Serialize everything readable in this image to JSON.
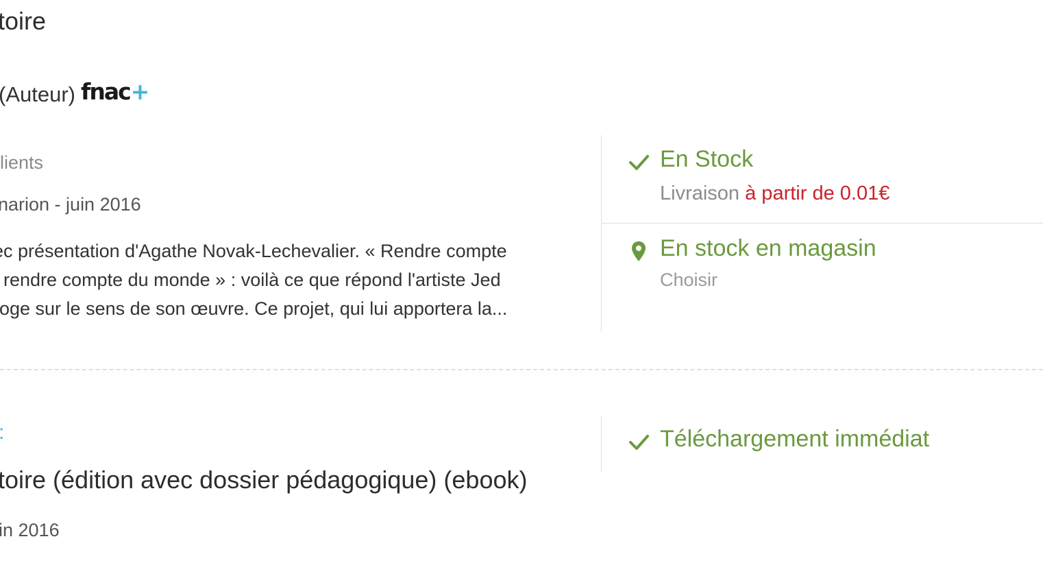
{
  "product": {
    "title_fragment": "toire",
    "author_label": "(Auteur)",
    "brand_logo": {
      "main": "fnac",
      "plus": "+",
      "accent": "#3fb6d9"
    },
    "reviews_fragment": "lients",
    "publication_fragment": "narion - juin 2016",
    "description_lines": [
      "ec présentation d'Agathe Novak-Lechevalier. « Rendre compte",
      "t rendre compte du monde » : voilà ce que répond l'artiste Jed",
      "roge sur le sens de son œuvre. Ce projet, qui lui apportera la..."
    ]
  },
  "availability": {
    "stock_icon": "checkmark-icon",
    "stock_label": "En Stock",
    "delivery_prefix": "Livraison",
    "delivery_price": "à partir de 0.01€",
    "store_icon": "map-pin-icon",
    "store_label": "En stock en magasin",
    "store_action": "Choisir",
    "colors": {
      "green": "#6a9a3e",
      "red": "#c8232c"
    }
  },
  "ebook": {
    "label_fragment": ":",
    "title_fragment": "toire (édition avec dossier pédagogique) (ebook)",
    "date_fragment": "in 2016",
    "download_icon": "checkmark-icon",
    "download_label": "Téléchargement immédiat"
  }
}
